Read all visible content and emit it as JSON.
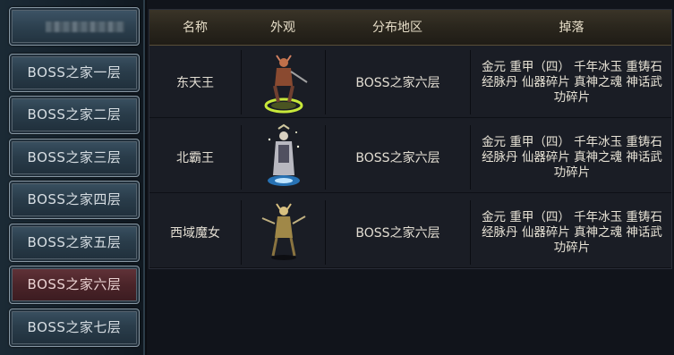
{
  "sidebar": {
    "items": [
      {
        "label": ""
      },
      {
        "label": "BOSS之家一层"
      },
      {
        "label": "BOSS之家二层"
      },
      {
        "label": "BOSS之家三层"
      },
      {
        "label": "BOSS之家四层"
      },
      {
        "label": "BOSS之家五层"
      },
      {
        "label": "BOSS之家六层",
        "active": true
      },
      {
        "label": "BOSS之家七层"
      }
    ]
  },
  "table": {
    "headers": [
      "名称",
      "外观",
      "分布地区",
      "掉落"
    ],
    "rows": [
      {
        "name": "东天王",
        "appearance_icon": "boss-figure-dongtianwang",
        "region": "BOSS之家六层",
        "drops": [
          "金元 重甲（四） 千年冰玉 重铸石",
          "经脉丹 仙器碎片 真神之魂 神话武",
          "功碎片"
        ]
      },
      {
        "name": "北霸王",
        "appearance_icon": "boss-figure-beibawang",
        "region": "BOSS之家六层",
        "drops": [
          "金元 重甲（四） 千年冰玉 重铸石",
          "经脉丹 仙器碎片 真神之魂 神话武",
          "功碎片"
        ]
      },
      {
        "name": "西域魔女",
        "appearance_icon": "boss-figure-xiyumonv",
        "region": "BOSS之家六层",
        "drops": [
          "金元 重甲（四） 千年冰玉 重铸石",
          "经脉丹 仙器碎片 真神之魂 神话武",
          "功碎片"
        ]
      }
    ]
  }
}
